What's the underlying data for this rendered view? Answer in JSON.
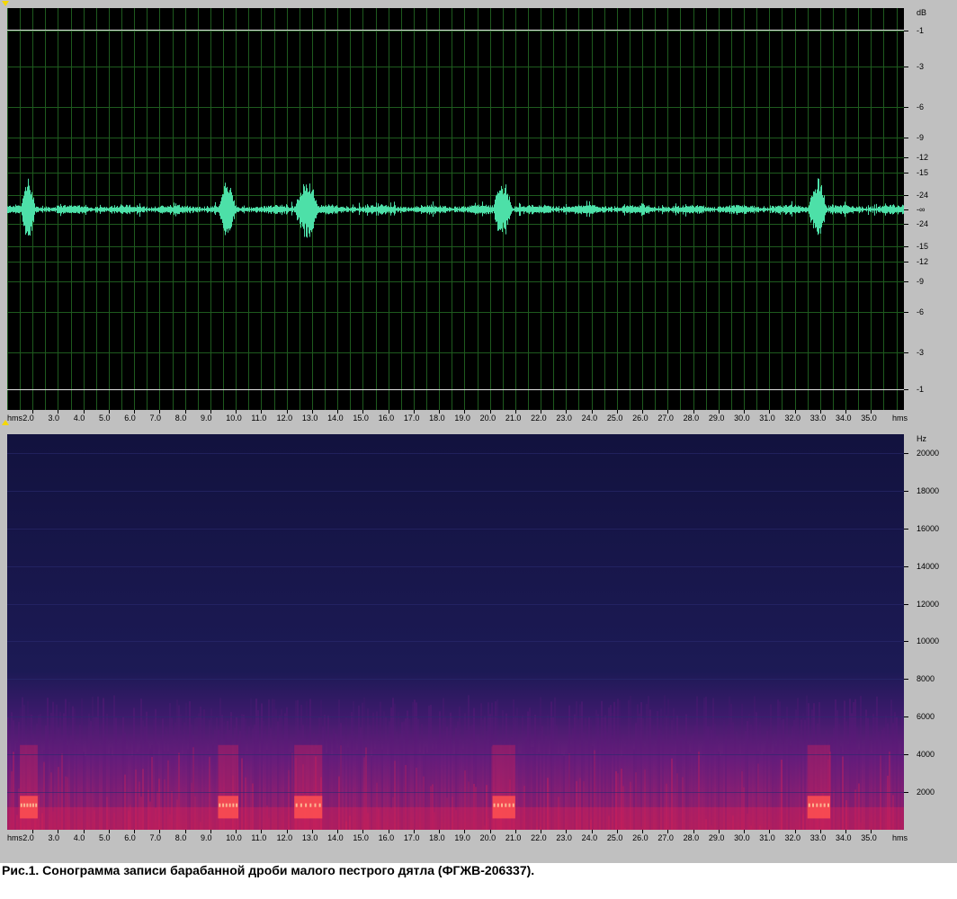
{
  "caption": "Рис.1. Сонограмма записи барабанной дроби малого пестрого дятла (ФГЖВ-206337).",
  "time_axis": {
    "unit_label": "hms",
    "tick_labels": [
      "2.0",
      "3.0",
      "4.0",
      "5.0",
      "6.0",
      "7.0",
      "8.0",
      "9.0",
      "10.0",
      "11.0",
      "12.0",
      "13.0",
      "14.0",
      "15.0",
      "16.0",
      "17.0",
      "18.0",
      "19.0",
      "20.0",
      "21.0",
      "22.0",
      "23.0",
      "24.0",
      "25.0",
      "26.0",
      "27.0",
      "28.0",
      "29.0",
      "30.0",
      "31.0",
      "32.0",
      "33.0",
      "34.0",
      "35.0"
    ]
  },
  "waveform": {
    "db_unit": "dB",
    "db_labels": [
      "-1",
      "-3",
      "-6",
      "-9",
      "-12",
      "-15",
      "-24",
      "-∞",
      "-24",
      "-15",
      "-12",
      "-9",
      "-6",
      "-3",
      "-1"
    ],
    "colors": {
      "background": "#000000",
      "trace": "#4de0a8",
      "grid": "#1e5a1e",
      "limit_line": "#e0e0e0"
    }
  },
  "spectrogram": {
    "freq_unit": "Hz",
    "freq_labels": [
      "20000",
      "18000",
      "16000",
      "14000",
      "12000",
      "10000",
      "8000",
      "6000",
      "4000",
      "2000"
    ],
    "colors": {
      "background": "#14144a",
      "mid": "#5a1a78",
      "hot": "#d0205a",
      "peak": "#ff5050"
    }
  },
  "chart_data": {
    "type": "area",
    "title": "",
    "xlabel": "hms",
    "ylabel": "dB",
    "x_range": [
      1.0,
      36.3
    ],
    "drum_bursts": [
      {
        "start": 1.5,
        "end": 2.2
      },
      {
        "start": 9.3,
        "end": 10.1
      },
      {
        "start": 12.3,
        "end": 13.4
      },
      {
        "start": 20.1,
        "end": 21.0
      },
      {
        "start": 32.5,
        "end": 33.4
      }
    ],
    "spectrogram_energy_ceiling_hz": 6500,
    "spectrogram_ylim": [
      0,
      21000
    ]
  }
}
